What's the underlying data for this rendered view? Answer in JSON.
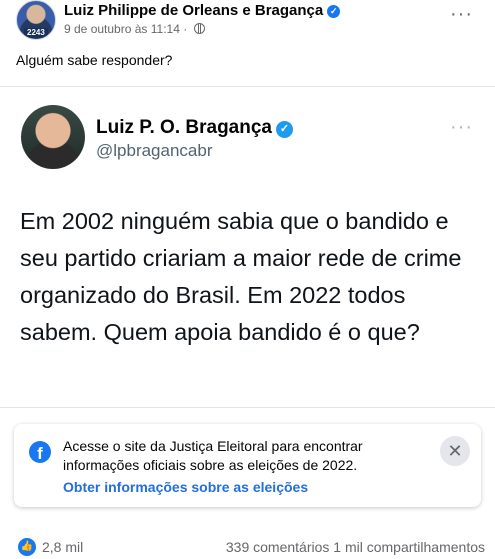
{
  "post": {
    "author": "Luiz Philippe de Orleans e Bragança",
    "avatar_badge": "2243",
    "date": "9 de outubro às 11:14",
    "separator": "·",
    "text": "Alguém sabe responder?",
    "more_icon": "···"
  },
  "tweet": {
    "name": "Luiz P. O. Bragança",
    "handle": "@lpbragancabr",
    "body": "Em 2002 ninguém sabia que o bandido e seu partido criariam a maior rede de crime organizado do Brasil. Em 2022 todos sabem. Quem apoia bandido é o que?",
    "more_icon": "···"
  },
  "notice": {
    "text": "Acesse o site da Justiça Eleitoral para encontrar informações oficiais sobre as eleições de 2022.",
    "link": "Obter informações sobre as eleições",
    "close_icon": "✕",
    "logo": "f"
  },
  "footer": {
    "likes": "2,8 mil",
    "stats": "339 comentários  1 mil compartilhamentos"
  },
  "colors": {
    "accent": "#1877f2",
    "link": "#216fdb",
    "muted": "#65676b"
  }
}
